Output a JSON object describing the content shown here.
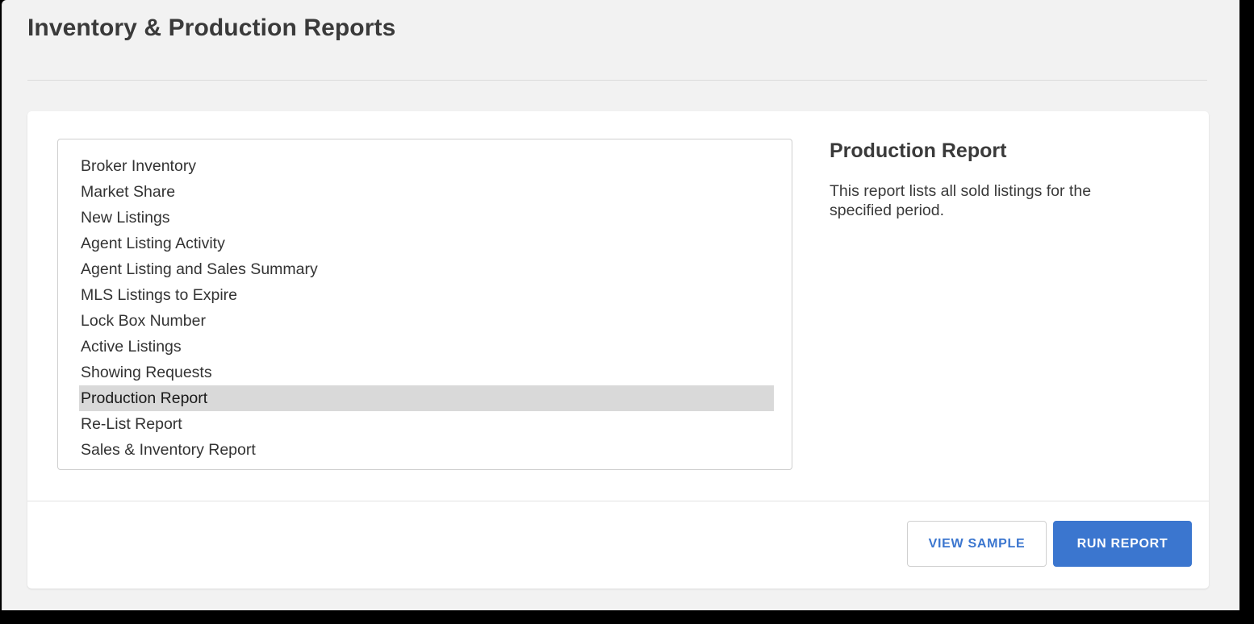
{
  "header": {
    "title": "Inventory & Production Reports"
  },
  "report_list": {
    "name": "report-type-list",
    "selected_index": 9,
    "items": [
      {
        "label": "Broker Inventory"
      },
      {
        "label": "Market Share"
      },
      {
        "label": "New Listings"
      },
      {
        "label": "Agent Listing Activity"
      },
      {
        "label": "Agent Listing and Sales Summary"
      },
      {
        "label": "MLS Listings to Expire"
      },
      {
        "label": "Lock Box Number"
      },
      {
        "label": "Active Listings"
      },
      {
        "label": "Showing Requests"
      },
      {
        "label": "Production Report"
      },
      {
        "label": "Re-List Report"
      },
      {
        "label": "Sales & Inventory Report"
      }
    ]
  },
  "detail": {
    "title": "Production Report",
    "description": "This report lists all sold listings for the specified period."
  },
  "footer": {
    "view_sample_label": "VIEW SAMPLE",
    "run_report_label": "RUN REPORT"
  },
  "colors": {
    "primary_blue": "#3b76cf",
    "page_background": "#f2f2f2",
    "card_background": "#ffffff",
    "selected_row": "#d9d9d9",
    "text_dark": "#3a3a3a",
    "border_gray": "#cfcfcf"
  }
}
